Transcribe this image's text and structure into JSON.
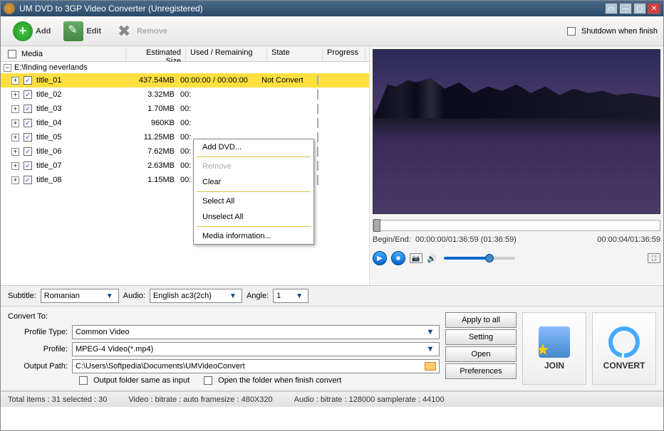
{
  "window": {
    "title": "UM DVD to 3GP Video Converter  (Unregistered)"
  },
  "toolbar": {
    "add": "Add",
    "edit": "Edit",
    "remove": "Remove",
    "shutdown_label": "Shutdown when finish"
  },
  "columns": {
    "media": "Media",
    "size": "Estimated Size",
    "used": "Used / Remaining",
    "state": "State",
    "progress": "Progress"
  },
  "tree": {
    "root": "E:\\finding neverlands",
    "items": [
      {
        "title": "title_01",
        "size": "437.54MB",
        "used": "00:00:00 / 00:00:00",
        "state": "Not Convert",
        "selected": true
      },
      {
        "title": "title_02",
        "size": "3.32MB",
        "used": "00:"
      },
      {
        "title": "title_03",
        "size": "1.70MB",
        "used": "00:"
      },
      {
        "title": "title_04",
        "size": "960KB",
        "used": "00:"
      },
      {
        "title": "title_05",
        "size": "11.25MB",
        "used": "00:"
      },
      {
        "title": "title_06",
        "size": "7.62MB",
        "used": "00:"
      },
      {
        "title": "title_07",
        "size": "2.63MB",
        "used": "00:"
      },
      {
        "title": "title_08",
        "size": "1.15MB",
        "used": "00:"
      }
    ]
  },
  "context_menu": {
    "add_dvd": "Add DVD...",
    "remove": "Remove",
    "clear": "Clear",
    "select_all": "Select All",
    "unselect_all": "Unselect All",
    "media_info": "Media information..."
  },
  "preview": {
    "begin_end_label": "Begin/End:",
    "begin_end_value": "00:00:00/01:36:59 (01:36:59)",
    "playtime": "00:00:04/01:36:59"
  },
  "options": {
    "subtitle_label": "Subtitle:",
    "subtitle_value": "Romanian",
    "audio_label": "Audio:",
    "audio_value": "English ac3(2ch)",
    "angle_label": "Angle:",
    "angle_value": "1"
  },
  "convert": {
    "heading": "Convert To:",
    "profile_type_label": "Profile Type:",
    "profile_type_value": "Common Video",
    "profile_label": "Profile:",
    "profile_value": "MPEG-4 Video(*.mp4)",
    "output_label": "Output Path:",
    "output_value": "C:\\Users\\Softpedia\\Documents\\UMVideoConvert",
    "same_as_input": "Output folder same as input",
    "open_when_finish": "Open the folder when finish convert",
    "apply_all": "Apply to all",
    "setting": "Setting",
    "open": "Open",
    "preferences": "Preferences",
    "join": "JOIN",
    "convert_btn": "CONVERT"
  },
  "status": {
    "items": "Total items : 31  selected : 30",
    "video": "Video : bitrate : auto framesize : 480X320",
    "audio": "Audio : bitrate : 128000 samplerate : 44100"
  }
}
